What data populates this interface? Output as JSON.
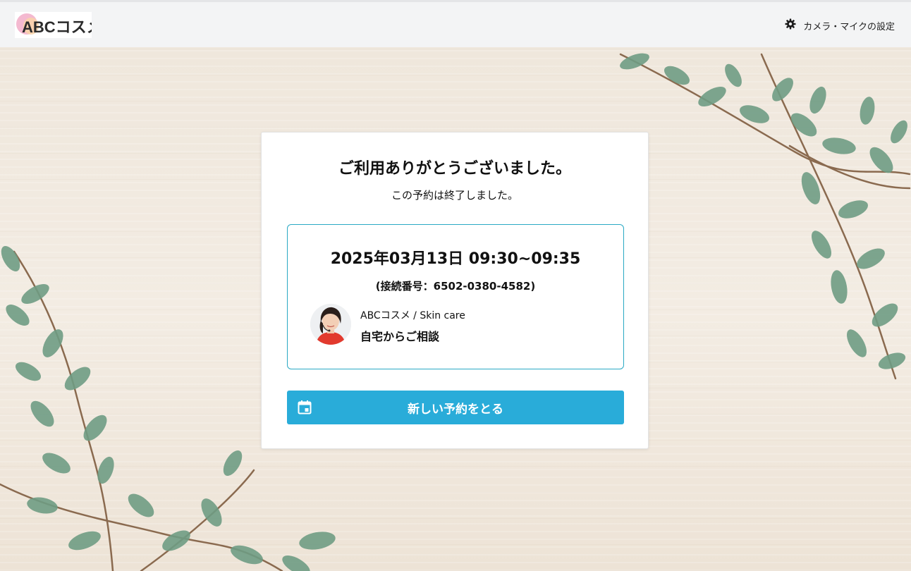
{
  "header": {
    "logo_text": "ABCコスメ",
    "settings_label": "カメラ・マイクの設定",
    "settings_icon": "gear-icon"
  },
  "card": {
    "title": "ご利用ありがとうございました。",
    "subtitle": "この予約は終了しました。",
    "reservation": {
      "datetime": "2025年03月13日 09:30~09:35",
      "connection": "(接続番号：6502-0380-4582)",
      "staff_line": "ABCコスメ / Skin care",
      "plan": "自宅からご相談"
    },
    "new_reservation_button": {
      "label": "新しい予約をとる",
      "icon": "calendar-icon"
    }
  },
  "colors": {
    "accent": "#29acd9",
    "box_border": "#2aa9c4",
    "header_bg": "#f3f4f5"
  }
}
